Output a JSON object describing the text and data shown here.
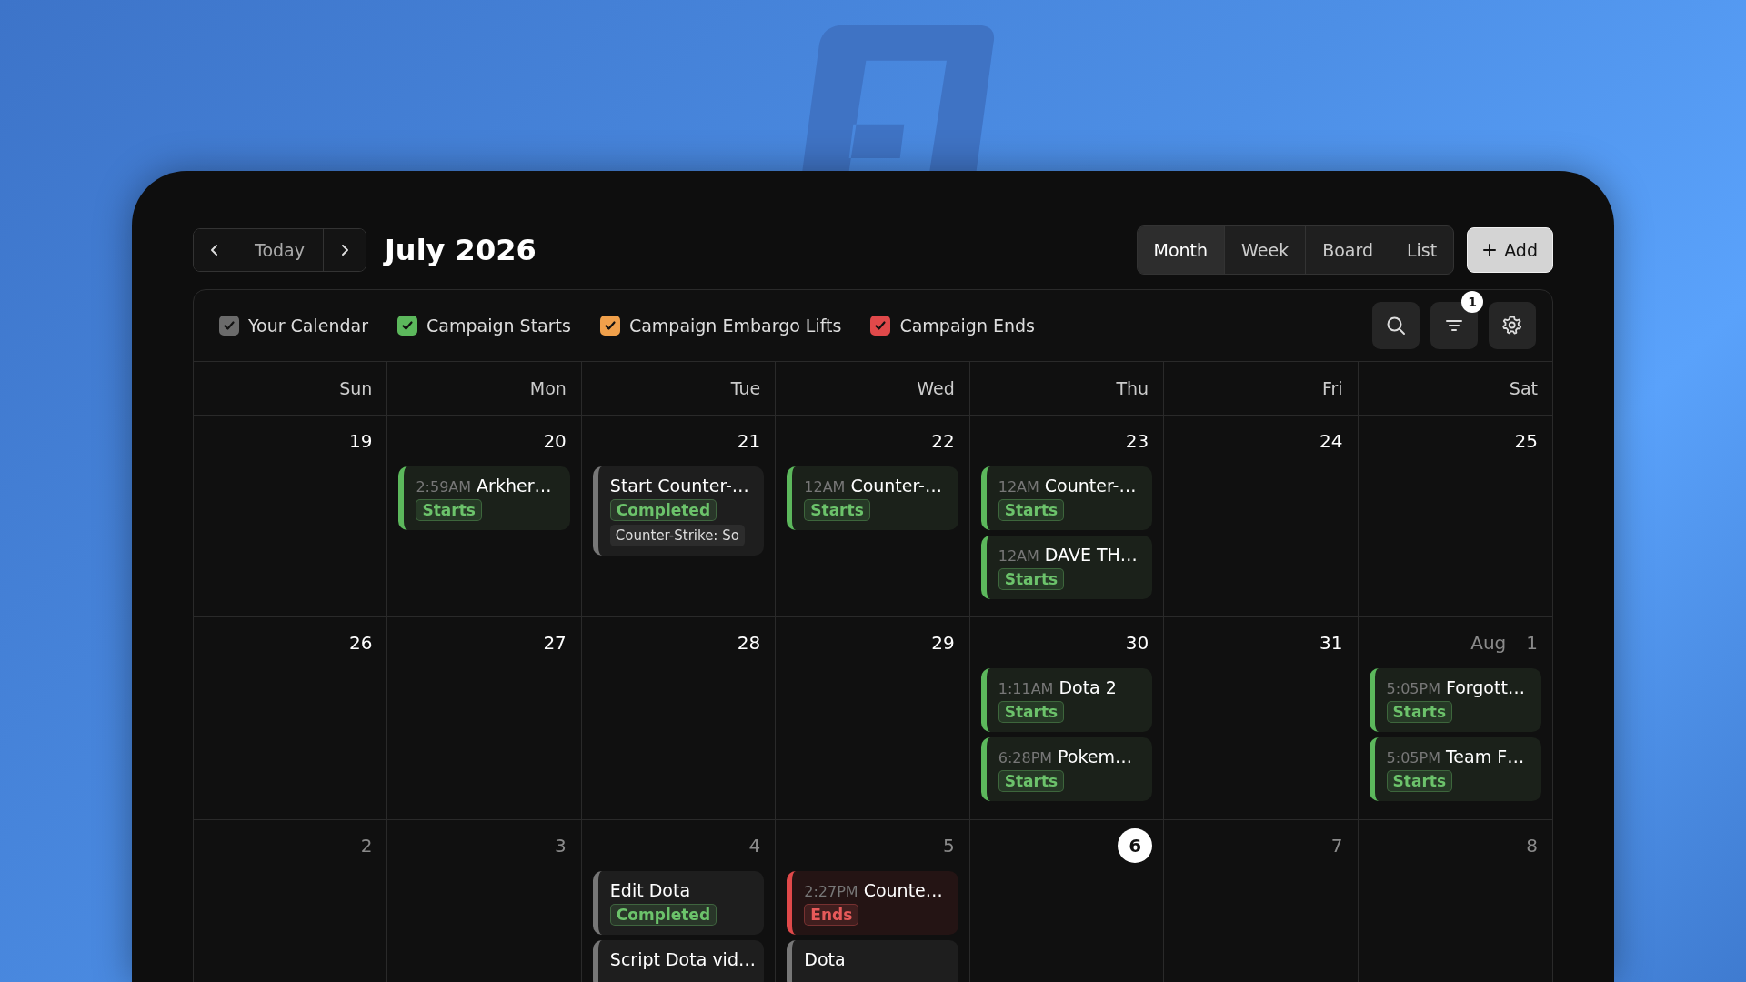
{
  "toolbar": {
    "today_button": "Today",
    "title": "July 2026",
    "add_button": "Add"
  },
  "views": [
    {
      "label": "Month",
      "selected": true
    },
    {
      "label": "Week",
      "selected": false
    },
    {
      "label": "Board",
      "selected": false
    },
    {
      "label": "List",
      "selected": false
    }
  ],
  "calendars": [
    {
      "label": "Your Calendar",
      "color": "#6b6b6b",
      "checked": true
    },
    {
      "label": "Campaign Starts",
      "color": "#5cb85c",
      "checked": true
    },
    {
      "label": "Campaign Embargo Lifts",
      "color": "#f0a04b",
      "checked": true
    },
    {
      "label": "Campaign Ends",
      "color": "#e0494a",
      "checked": true
    }
  ],
  "filter_badge": "1",
  "weekdays": [
    "Sun",
    "Mon",
    "Tue",
    "Wed",
    "Thu",
    "Fri",
    "Sat"
  ],
  "weeks": [
    [
      {
        "day": "19",
        "muted": false,
        "today": false
      },
      {
        "day": "20",
        "muted": false,
        "today": false,
        "events": [
          {
            "kind": "starts",
            "time": "2:59AM",
            "title": "Arkher…",
            "tag": {
              "text": "Starts",
              "color": "#6cc36b"
            }
          }
        ]
      },
      {
        "day": "21",
        "muted": false,
        "today": false,
        "events": [
          {
            "kind": "task",
            "title": "Start Counter-…",
            "tag": {
              "text": "Completed",
              "color": "#6cc36b"
            },
            "note": "Counter-Strike: So"
          }
        ]
      },
      {
        "day": "22",
        "muted": false,
        "today": false,
        "events": [
          {
            "kind": "starts",
            "time": "12AM",
            "title": "Counter-…",
            "tag": {
              "text": "Starts",
              "color": "#6cc36b"
            }
          }
        ]
      },
      {
        "day": "23",
        "muted": false,
        "today": false,
        "events": [
          {
            "kind": "starts",
            "time": "12AM",
            "title": "Counter-…",
            "tag": {
              "text": "Starts",
              "color": "#6cc36b"
            }
          },
          {
            "kind": "starts",
            "time": "12AM",
            "title": "DAVE TH…",
            "tag": {
              "text": "Starts",
              "color": "#6cc36b"
            }
          }
        ]
      },
      {
        "day": "24",
        "muted": false,
        "today": false
      },
      {
        "day": "25",
        "muted": false,
        "today": false
      }
    ],
    [
      {
        "day": "26",
        "muted": false,
        "today": false
      },
      {
        "day": "27",
        "muted": false,
        "today": false
      },
      {
        "day": "28",
        "muted": false,
        "today": false
      },
      {
        "day": "29",
        "muted": false,
        "today": false
      },
      {
        "day": "30",
        "muted": false,
        "today": false,
        "events": [
          {
            "kind": "starts",
            "time": "1:11AM",
            "title": "Dota 2",
            "tag": {
              "text": "Starts",
              "color": "#6cc36b"
            }
          },
          {
            "kind": "starts",
            "time": "6:28PM",
            "title": "Pokem…",
            "tag": {
              "text": "Starts",
              "color": "#6cc36b"
            }
          }
        ]
      },
      {
        "day": "31",
        "muted": false,
        "today": false
      },
      {
        "month": "Aug",
        "day": "1",
        "muted": true,
        "today": false,
        "events": [
          {
            "kind": "starts",
            "time": "5:05PM",
            "title": "Forgott…",
            "tag": {
              "text": "Starts",
              "color": "#6cc36b"
            }
          },
          {
            "kind": "starts",
            "time": "5:05PM",
            "title": "Team F…",
            "tag": {
              "text": "Starts",
              "color": "#6cc36b"
            }
          }
        ]
      }
    ],
    [
      {
        "day": "2",
        "muted": true,
        "today": false
      },
      {
        "day": "3",
        "muted": true,
        "today": false
      },
      {
        "day": "4",
        "muted": true,
        "today": false,
        "events": [
          {
            "kind": "task",
            "title": "Edit Dota",
            "tag": {
              "text": "Completed",
              "color": "#6cc36b"
            }
          },
          {
            "kind": "task",
            "title": "Script Dota vid…"
          }
        ]
      },
      {
        "day": "5",
        "muted": true,
        "today": false,
        "events": [
          {
            "kind": "ends",
            "time": "2:27PM",
            "title": "Counte…",
            "tag": {
              "text": "Ends",
              "color": "#e65a5a"
            }
          },
          {
            "kind": "task",
            "title": "Dota"
          }
        ]
      },
      {
        "day": "6",
        "muted": false,
        "today": true
      },
      {
        "day": "7",
        "muted": true,
        "today": false
      },
      {
        "day": "8",
        "muted": true,
        "today": false
      }
    ]
  ]
}
